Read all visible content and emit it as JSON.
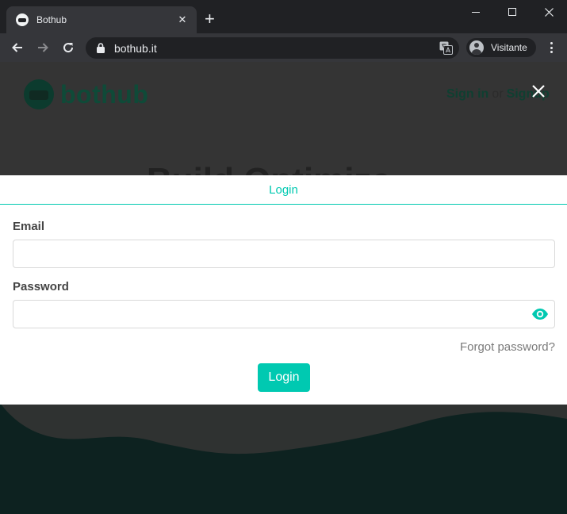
{
  "browser": {
    "tab_title": "Bothub",
    "tab_close": "✕",
    "new_tab": "+",
    "url": "bothub.it",
    "profile_name": "Visitante"
  },
  "site": {
    "logo_text": "bothub",
    "sign_in": "Sign in",
    "or": "or",
    "sign_up": "Signup",
    "hero_title": "Build Optimize"
  },
  "modal": {
    "tab_login": "Login",
    "email_label": "Email",
    "email_value": "",
    "password_label": "Password",
    "password_value": "",
    "forgot_password": "Forgot password?",
    "login_button": "Login"
  },
  "colors": {
    "accent": "#00c9b1",
    "chrome_dark": "#202124",
    "chrome_toolbar": "#35363a",
    "overlay_page": "#343434",
    "page_bottom": "#0d2220"
  },
  "icons": {
    "tab": "bothub-favicon-icon",
    "back": "arrow-left-icon",
    "forward": "arrow-right-icon",
    "reload": "reload-icon",
    "secure": "lock-icon",
    "translate": "translate-icon",
    "profile": "account-circle-icon",
    "menu": "kebab-menu-icon",
    "close_modal": "close-icon",
    "password_toggle": "eye-icon"
  }
}
